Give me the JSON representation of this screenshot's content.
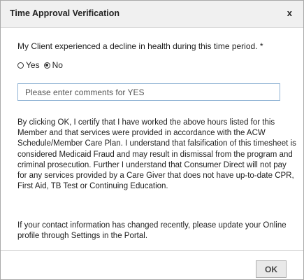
{
  "dialog": {
    "title": "Time Approval Verification",
    "close_label": "x"
  },
  "question": {
    "text": "My Client experienced a decline in health during this time period. *",
    "options": [
      {
        "label": "Yes",
        "selected": false
      },
      {
        "label": "No",
        "selected": true
      }
    ]
  },
  "comment": {
    "placeholder": "Please enter comments for YES",
    "value": ""
  },
  "disclaimer": "By clicking OK, I certify that I have worked the above hours listed for this Member and that services were provided in accordance with the ACW Schedule/Member Care Plan.  I understand that falsification of this timesheet is considered Medicaid Fraud and may result in dismissal from the program and criminal prosecution.  Further I understand that Consumer Direct will not pay for any services provided by a Care Giver that does not have up-to-date CPR, First Aid, TB Test or Continuing Education.",
  "update_notice": "If your contact information has changed recently, please update your Online profile through Settings in the Portal.",
  "footer": {
    "ok_label": "OK"
  }
}
